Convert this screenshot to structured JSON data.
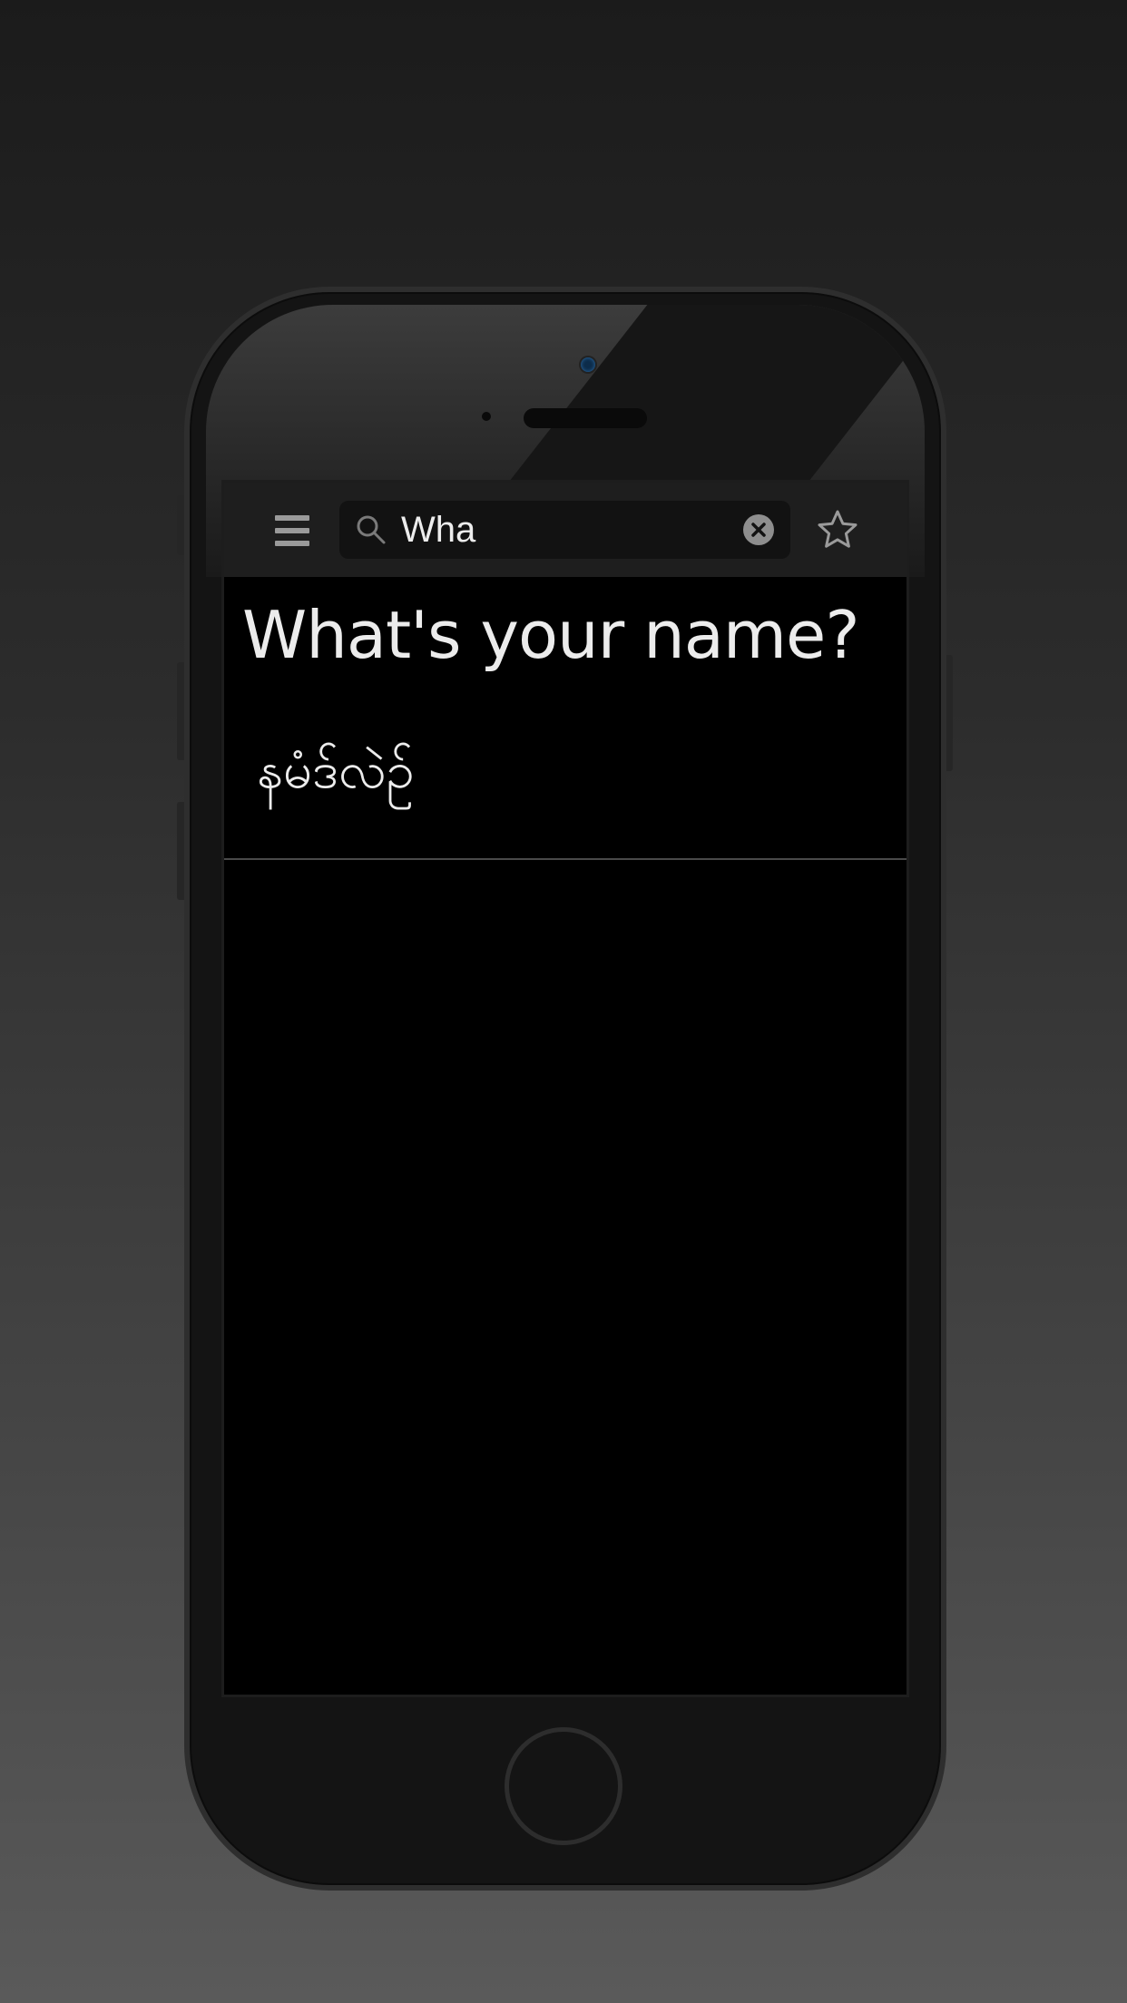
{
  "search": {
    "value": "Wha",
    "placeholder": ""
  },
  "icons": {
    "menu": "hamburger-menu-icon",
    "search": "magnifier-icon",
    "clear": "clear-x-icon",
    "favorite": "star-outline-icon"
  },
  "results": [
    {
      "phrase": "What's your name?",
      "translation": "နမံဒ်လဲဉ်"
    }
  ],
  "colors": {
    "toolbar_bg": "#1e1e1e",
    "screen_bg": "#000000",
    "text": "#ececec",
    "icon": "#9a9a9a"
  }
}
